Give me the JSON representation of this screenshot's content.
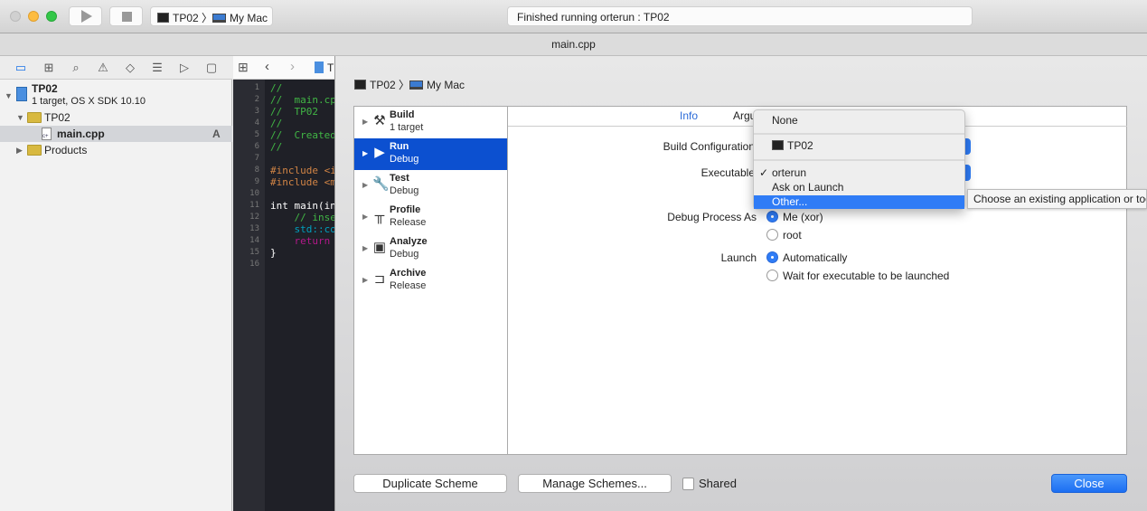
{
  "toolbar": {
    "run_icon": "play-icon",
    "stop_icon": "stop-icon",
    "scheme": "TP02",
    "destination": "My Mac",
    "status": "Finished running orterun : TP02"
  },
  "tab": {
    "title": "main.cpp"
  },
  "navigator": {
    "icons": [
      "folder-icon",
      "hierarchy-icon",
      "search-icon",
      "warning-icon",
      "test-icon",
      "debug-icon",
      "breakpoint-icon",
      "report-icon"
    ],
    "project": {
      "name": "TP02",
      "subtitle": "1 target, OS X SDK 10.10"
    },
    "items": [
      {
        "label": "TP02"
      },
      {
        "label": "main.cpp",
        "badge": "A"
      },
      {
        "label": "Products"
      }
    ]
  },
  "editor": {
    "jump": "T",
    "lines": [
      "1",
      "2",
      "3",
      "4",
      "5",
      "6",
      "7",
      "8",
      "9",
      "10",
      "11",
      "12",
      "13",
      "14",
      "15",
      "16"
    ],
    "code": [
      [
        "//",
        "#41b645"
      ],
      [
        "//  main.cp",
        "#41b645"
      ],
      [
        "//  TP02",
        "#41b645"
      ],
      [
        "//",
        "#41b645"
      ],
      [
        "//  Created",
        "#41b645"
      ],
      [
        "//",
        "#41b645"
      ],
      [
        "",
        ""
      ],
      [
        "#include <i",
        "#d28445"
      ],
      [
        "#include <m",
        "#d28445"
      ],
      [
        "",
        ""
      ],
      [
        "int main(in",
        "#ffffff"
      ],
      [
        "    // inse",
        "#41b645"
      ],
      [
        "    std::co",
        "#00a0be"
      ],
      [
        "    return",
        "#b21889"
      ],
      [
        "}",
        "#ffffff"
      ],
      [
        "",
        ""
      ]
    ]
  },
  "sheet": {
    "scheme": "TP02",
    "destination": "My Mac",
    "actions": [
      {
        "name": "Build",
        "sub": "1 target"
      },
      {
        "name": "Run",
        "sub": "Debug"
      },
      {
        "name": "Test",
        "sub": "Debug"
      },
      {
        "name": "Profile",
        "sub": "Release"
      },
      {
        "name": "Analyze",
        "sub": "Debug"
      },
      {
        "name": "Archive",
        "sub": "Release"
      }
    ],
    "tabs": [
      "Info",
      "Argu"
    ],
    "build_config_label": "Build Configuration",
    "executable_label": "Executable",
    "debug_as_label": "Debug Process As",
    "debug_as": [
      "Me (xor)",
      "root"
    ],
    "debug_as_selected": "Me (xor)",
    "launch_label": "Launch",
    "launch": [
      "Automatically",
      "Wait for executable to be launched"
    ],
    "launch_selected": "Automatically",
    "menu": {
      "none": "None",
      "target": "TP02",
      "check": "✓",
      "items": [
        "orterun",
        "Ask on Launch",
        "Other..."
      ],
      "selected": "orterun",
      "highlighted": "Other..."
    },
    "tooltip": "Choose an existing application or tool",
    "duplicate": "Duplicate Scheme",
    "manage": "Manage Schemes...",
    "shared": "Shared",
    "shared_checked": false,
    "close": "Close"
  },
  "colors": {
    "selection": "#0c50d0",
    "accent": "#2f7cf6",
    "menu_highlight": "#2f7cf6"
  }
}
